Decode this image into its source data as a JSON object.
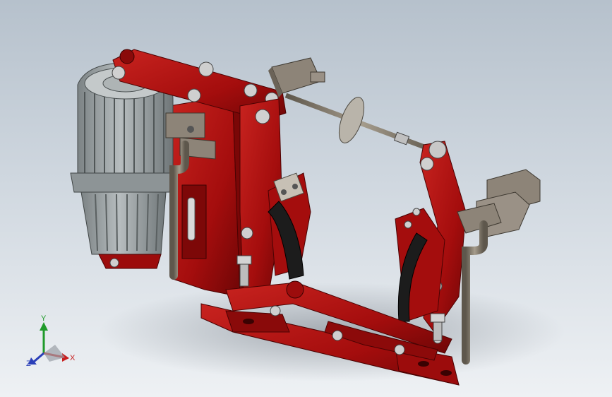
{
  "viewport": {
    "background_top": "#b6c1cc",
    "background_bottom": "#eef1f4"
  },
  "model": {
    "frame_color": "#a40d0d",
    "frame_highlight": "#c8231f",
    "frame_shadow": "#6e0606",
    "motor_color": "#9aa1a3",
    "motor_shadow": "#6f7678",
    "pad_color": "#1c1c1c",
    "rod_color": "#857c6e",
    "bolt_color": "#cfcfcf"
  },
  "triad": {
    "x_label": "X",
    "y_label": "Y",
    "z_label": "Z",
    "x_color": "#c81e1e",
    "y_color": "#1f9a2a",
    "z_color": "#2a3fb8"
  }
}
